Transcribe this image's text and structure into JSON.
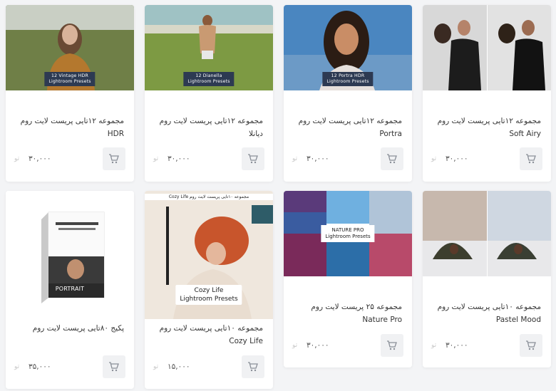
{
  "products": [
    {
      "title": "مجموعه ۱۲تایی پریست لایت روم HDR",
      "price": "۳۰,۰۰۰",
      "image_caption": "12 Vintage HDR\nLightroom Presets",
      "cart_icon": "cart-icon",
      "currency_icon": "toman-icon"
    },
    {
      "title": "مجموعه ۱۲تایی پریست لایت روم دیانلا",
      "price": "۳۰,۰۰۰",
      "image_caption": "12 Dianella\nLightroom Presets",
      "cart_icon": "cart-icon",
      "currency_icon": "toman-icon"
    },
    {
      "title": "مجموعه ۱۲تایی پریست لایت روم Portra",
      "price": "۳۰,۰۰۰",
      "image_caption": "12 Portra HDR\nLightroom Presets",
      "cart_icon": "cart-icon",
      "currency_icon": "toman-icon"
    },
    {
      "title": "مجموعه ۱۲تایی پریست لایت روم Soft Airy",
      "price": "۳۰,۰۰۰",
      "image_caption": "",
      "cart_icon": "cart-icon",
      "currency_icon": "toman-icon"
    },
    {
      "title": "پکیج ۸۰تایی پریست لایت روم",
      "price": "۳۵,۰۰۰",
      "image_caption": "PORTRAIT",
      "cart_icon": "cart-icon",
      "currency_icon": "toman-icon"
    },
    {
      "title": "مجموعه ۱۰تایی پریست لایت روم Cozy Life",
      "price": "۱۵,۰۰۰",
      "image_caption": "Cozy Life\nLightroom Presets",
      "image_header": "مجموعه ۱۰تایی پریست لایت روم Cozy Life",
      "cart_icon": "cart-icon",
      "currency_icon": "toman-icon"
    },
    {
      "title": "مجموعه ۲۵ پریست لایت روم Nature Pro",
      "price": "۳۰,۰۰۰",
      "image_caption": "NATURE PRO\nLightroom Presets",
      "cart_icon": "cart-icon",
      "currency_icon": "toman-icon"
    },
    {
      "title": "مجموعه ۱۰تایی پریست لایت روم Pastel Mood",
      "price": "۳۰,۰۰۰",
      "image_caption": "",
      "cart_icon": "cart-icon",
      "currency_icon": "toman-icon"
    }
  ],
  "colors": {
    "page_bg": "#f3f4f6",
    "card_bg": "#ffffff",
    "caption_bg": "#2d3a52",
    "button_bg": "#f0f1f3"
  }
}
